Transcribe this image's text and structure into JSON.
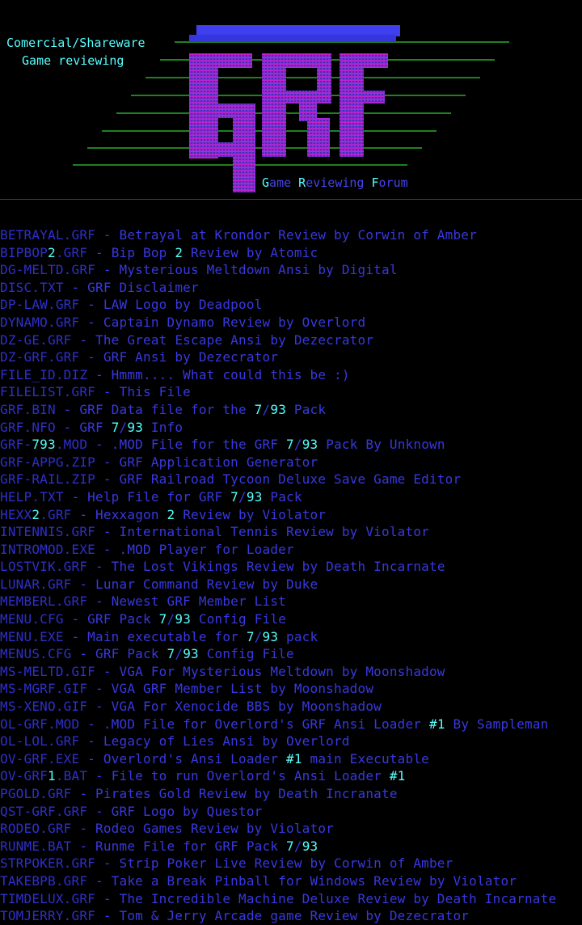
{
  "header": {
    "line1": "Comercial/Shareware",
    "line2": " Game reviewing",
    "logo_text": "GRF",
    "tagline": "Game Reviewing Forum"
  },
  "colors": {
    "background": "#000000",
    "text_blue": "#3030dd",
    "highlight_cyan": "#55ffff",
    "line_green": "#33dd33",
    "logo_top": "#4444ee",
    "logo_bottom": "#cc22cc"
  },
  "files": [
    {
      "name": "BETRAYAL.GRF",
      "desc": "Betrayal at Krondor Review by Corwin of Amber"
    },
    {
      "name": "BIPBOP2.GRF",
      "desc": "Bip Bop 2 Review by Atomic"
    },
    {
      "name": "DG-MELTD.GRF",
      "desc": "Mysterious Meltdown Ansi by Digital"
    },
    {
      "name": "DISC.TXT",
      "desc": "GRF Disclaimer"
    },
    {
      "name": "DP-LAW.GRF",
      "desc": "LAW Logo by Deadpool"
    },
    {
      "name": "DYNAMO.GRF",
      "desc": "Captain Dynamo Review by Overlord"
    },
    {
      "name": "DZ-GE.GRF",
      "desc": "The Great Escape Ansi by Dezecrator"
    },
    {
      "name": "DZ-GRF.GRF",
      "desc": "GRF Ansi by Dezecrator"
    },
    {
      "name": "FILE_ID.DIZ",
      "desc": "Hmmm.... What could this be :)"
    },
    {
      "name": "FILELIST.GRF",
      "desc": "This File"
    },
    {
      "name": "GRF.BIN",
      "desc": "GRF Data file for the 7/93 Pack"
    },
    {
      "name": "GRF.NFO",
      "desc": "GRF 7/93 Info"
    },
    {
      "name": "GRF-793.MOD",
      "desc": ".MOD File for the GRF 7/93 Pack By Unknown"
    },
    {
      "name": "GRF-APPG.ZIP",
      "desc": "GRF Application Generator"
    },
    {
      "name": "GRF-RAIL.ZIP",
      "desc": "GRF Railroad Tycoon Deluxe Save Game Editor"
    },
    {
      "name": "HELP.TXT",
      "desc": "Help File for GRF 7/93 Pack"
    },
    {
      "name": "HEXX2.GRF",
      "desc": "Hexxagon 2 Review by Violator"
    },
    {
      "name": "INTENNIS.GRF",
      "desc": "International Tennis Review by Violator"
    },
    {
      "name": "INTROMOD.EXE",
      "desc": ".MOD Player for Loader"
    },
    {
      "name": "LOSTVIK.GRF",
      "desc": "The Lost Vikings Review by Death Incarnate"
    },
    {
      "name": "LUNAR.GRF",
      "desc": "Lunar Command Review by Duke"
    },
    {
      "name": "MEMBERL.GRF",
      "desc": "Newest GRF Member List"
    },
    {
      "name": "MENU.CFG",
      "desc": "GRF Pack 7/93 Config File"
    },
    {
      "name": "MENU.EXE",
      "desc": "Main executable for 7/93 pack"
    },
    {
      "name": "MENUS.CFG",
      "desc": "GRF Pack 7/93 Config File"
    },
    {
      "name": "MS-MELTD.GIF",
      "desc": "VGA For Mysterious Meltdown by Moonshadow"
    },
    {
      "name": "MS-MGRF.GIF",
      "desc": "VGA GRF Member List by Moonshadow"
    },
    {
      "name": "MS-XENO.GIF",
      "desc": "VGA For Xenocide BBS by Moonshadow"
    },
    {
      "name": "OL-GRF.MOD",
      "desc": ".MOD File for Overlord's GRF Ansi Loader #1 By Sampleman"
    },
    {
      "name": "OL-LOL.GRF",
      "desc": "Legacy of Lies Ansi by Overlord"
    },
    {
      "name": "OV-GRF.EXE",
      "desc": "Overlord's Ansi Loader #1 main Executable"
    },
    {
      "name": "OV-GRF1.BAT",
      "desc": "File to run Overlord's Ansi Loader #1"
    },
    {
      "name": "PGOLD.GRF",
      "desc": "Pirates Gold Review by Death Incranate"
    },
    {
      "name": "QST-GRF.GRF",
      "desc": "GRF Logo by Questor"
    },
    {
      "name": "RODEO.GRF",
      "desc": "Rodeo Games Review by Violator"
    },
    {
      "name": "RUNME.BAT",
      "desc": "Runme File for GRF Pack 7/93"
    },
    {
      "name": "STRPOKER.GRF",
      "desc": "Strip Poker Live Review by Corwin of Amber"
    },
    {
      "name": "TAKEBPB.GRF",
      "desc": "Take a Break Pinball for Windows Review by Violator"
    },
    {
      "name": "TIMDELUX.GRF",
      "desc": "The Incredible Machine Deluxe Review by Death Incarnate"
    },
    {
      "name": "TOMJERRY.GRF",
      "desc": "Tom & Jerry Arcade game Review by Dezecrator"
    }
  ]
}
